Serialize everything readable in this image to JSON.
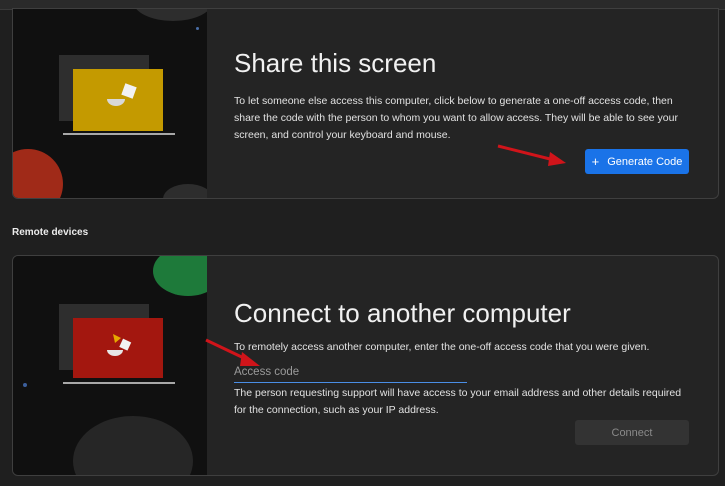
{
  "share": {
    "title": "Share this screen",
    "description": "To let someone else access this computer, click below to generate a one-off access code, then share the code with the person to whom you want to allow access. They will be able to see your screen, and control your keyboard and mouse.",
    "button_icon": "+",
    "button_label": "Generate Code"
  },
  "remote": {
    "section_label": "Remote devices"
  },
  "connect": {
    "title": "Connect to another computer",
    "description": "To remotely access another computer, enter the one-off access code that you were given.",
    "input_placeholder": "Access code",
    "input_value": "",
    "note": "The person requesting support will have access to your email address and other details required for the connection, such as your IP address.",
    "button_label": "Connect"
  },
  "colors": {
    "accent": "#1a73e8",
    "annotation_arrow": "#d0141a",
    "laptop_yellow": "#c49a00",
    "laptop_red": "#a3170f"
  }
}
